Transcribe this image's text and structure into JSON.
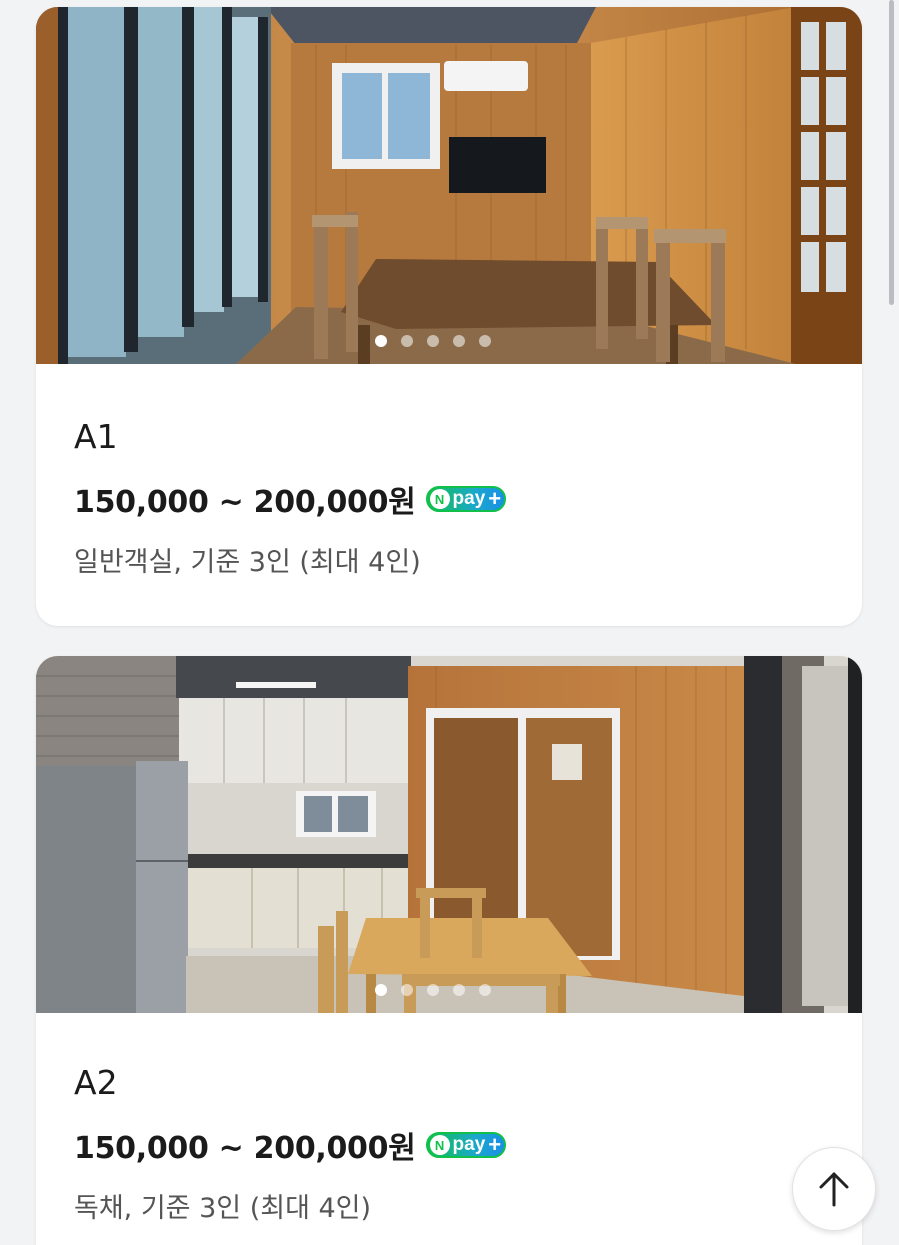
{
  "rooms": [
    {
      "name": "A1",
      "price": "150,000 ~ 200,000원",
      "pay_badge": "pay",
      "pay_badge_letter": "N",
      "description": "일반객실, 기준 3인 (최대 4인)",
      "photo": "room-photo-dining-wood-interior"
    },
    {
      "name": "A2",
      "price": "150,000 ~ 200,000원",
      "pay_badge": "pay",
      "pay_badge_letter": "N",
      "description": "독채, 기준 3인 (최대 4인)",
      "photo": "room-photo-kitchen-dining"
    }
  ],
  "carousel": {
    "count": 5,
    "active": 1
  },
  "icons": {
    "scroll_top": "arrow-up-icon",
    "pay_plus": "plus-icon"
  },
  "colors": {
    "npay_green": "#10c04a",
    "npay_blue": "#1a8fe6",
    "text": "#1b1b1b"
  }
}
